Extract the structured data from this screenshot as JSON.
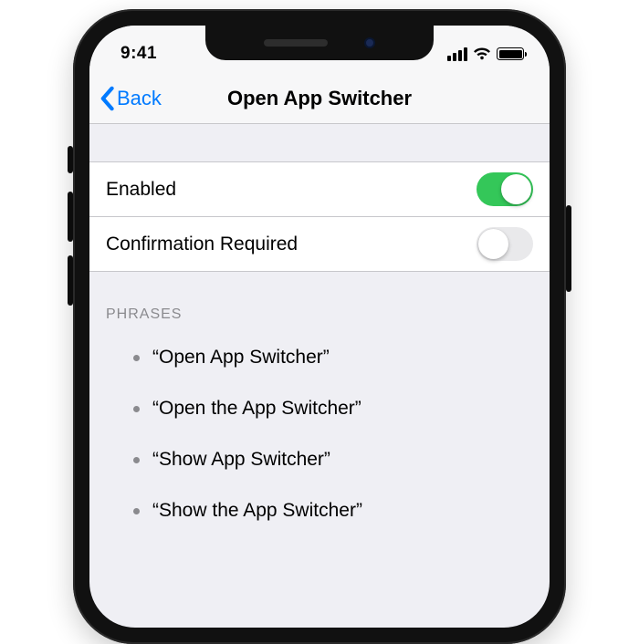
{
  "status": {
    "time": "9:41"
  },
  "nav": {
    "back": "Back",
    "title": "Open App Switcher"
  },
  "rows": {
    "enabled": {
      "label": "Enabled",
      "on": true
    },
    "confirm": {
      "label": "Confirmation Required",
      "on": false
    }
  },
  "phrases": {
    "header": "PHRASES",
    "items": [
      "“Open App Switcher”",
      "“Open the App Switcher”",
      "“Show App Switcher”",
      "“Show the App Switcher”"
    ]
  }
}
